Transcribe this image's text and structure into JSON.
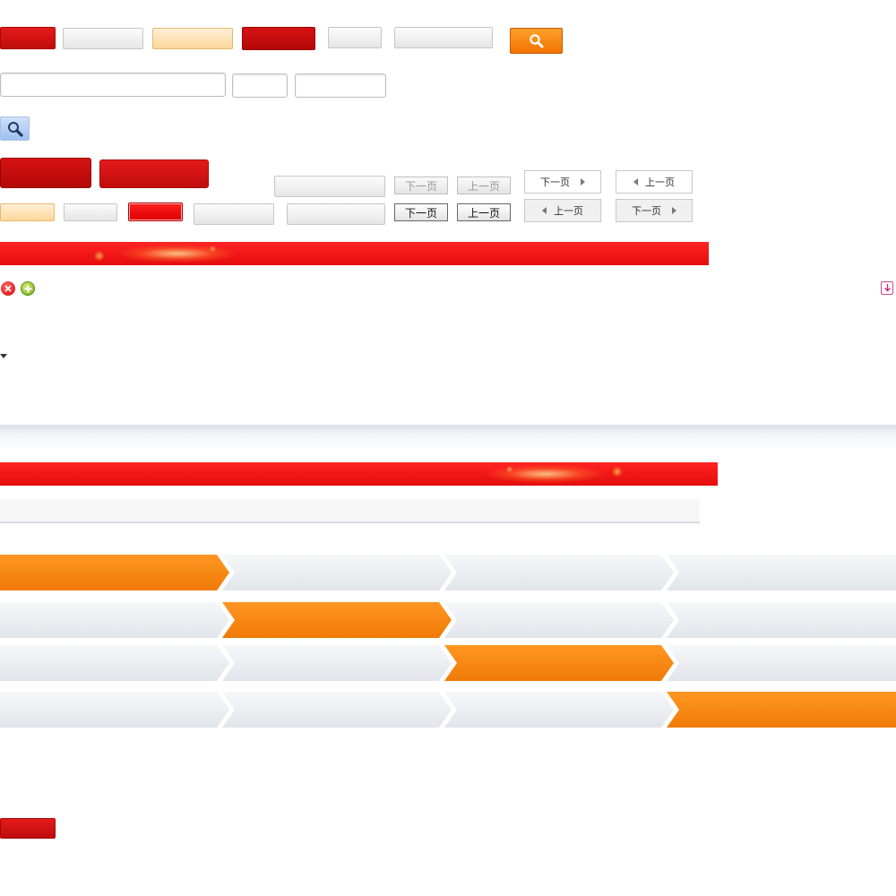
{
  "pager": {
    "next_label": "下一页",
    "prev_label": "上一页"
  },
  "icons": {
    "search": "search-icon",
    "remove": "remove-icon",
    "add": "add-icon",
    "download": "download-icon",
    "dropdown": "triangle-down-icon"
  },
  "colors": {
    "brand_red": "#e51a1a",
    "accent_orange": "#f27300",
    "step_active": "#f58a12",
    "step_inactive": "#e6e8ec"
  },
  "steps": {
    "rows": [
      {
        "active_index": 0
      },
      {
        "active_index": 1
      },
      {
        "active_index": 2
      },
      {
        "active_index": 3
      }
    ],
    "count": 4
  }
}
